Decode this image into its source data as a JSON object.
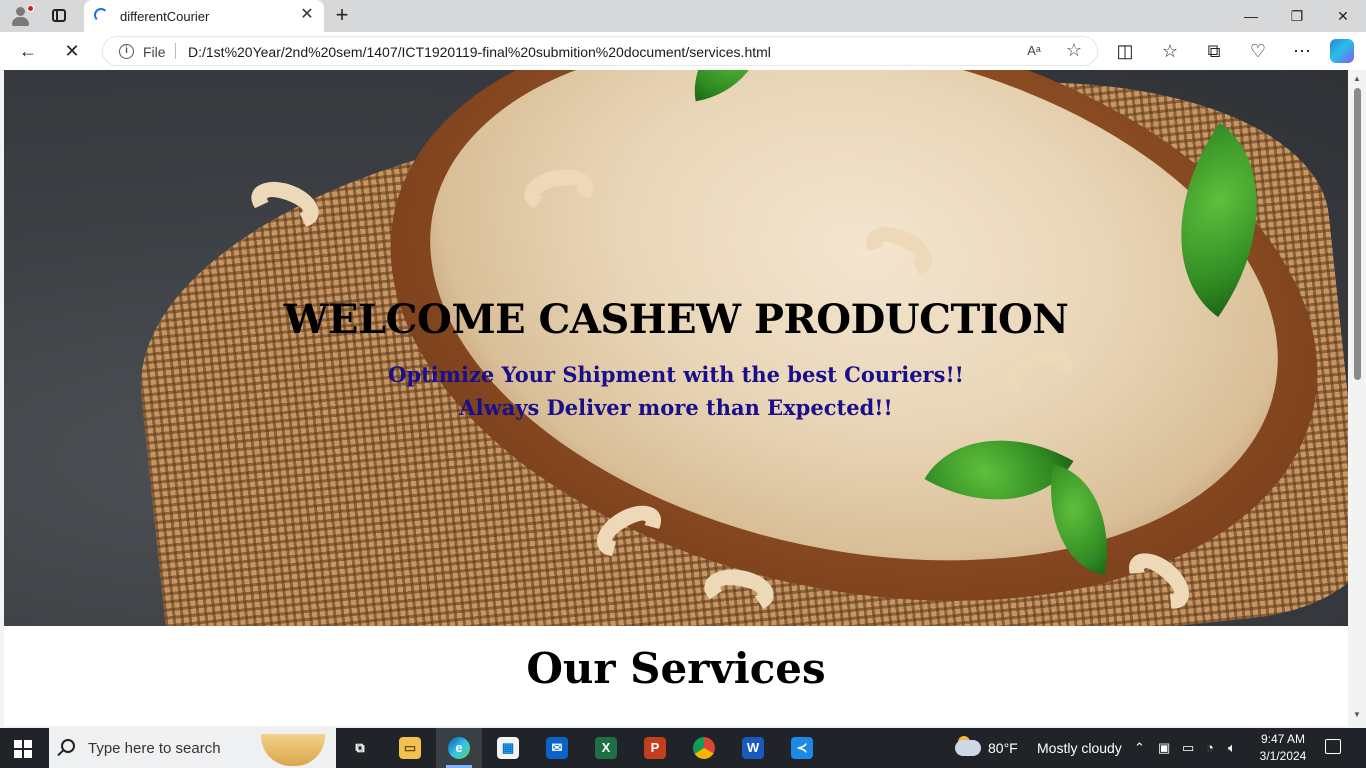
{
  "browser": {
    "tab_title": "differentCourier",
    "address": {
      "scheme_label": "File",
      "url": "D:/1st%20Year/2nd%20sem/1407/ICT1920119-final%20submition%20document/services.html"
    }
  },
  "page": {
    "hero_title": "WELCOME CASHEW PRODUCTION",
    "hero_line1": "Optimize Your Shipment with the best Couriers!!",
    "hero_line2": "Always Deliver more than Expected!!",
    "services_title": "Our Services"
  },
  "taskbar": {
    "search_placeholder": "Type here to search",
    "weather_temp": "80°F",
    "weather_desc": "Mostly cloudy",
    "time": "9:47 AM",
    "date": "3/1/2024"
  },
  "colors": {
    "tagline": "#1a0f8a",
    "edge_accent": "#0c59a4",
    "taskbar": "#202428"
  }
}
